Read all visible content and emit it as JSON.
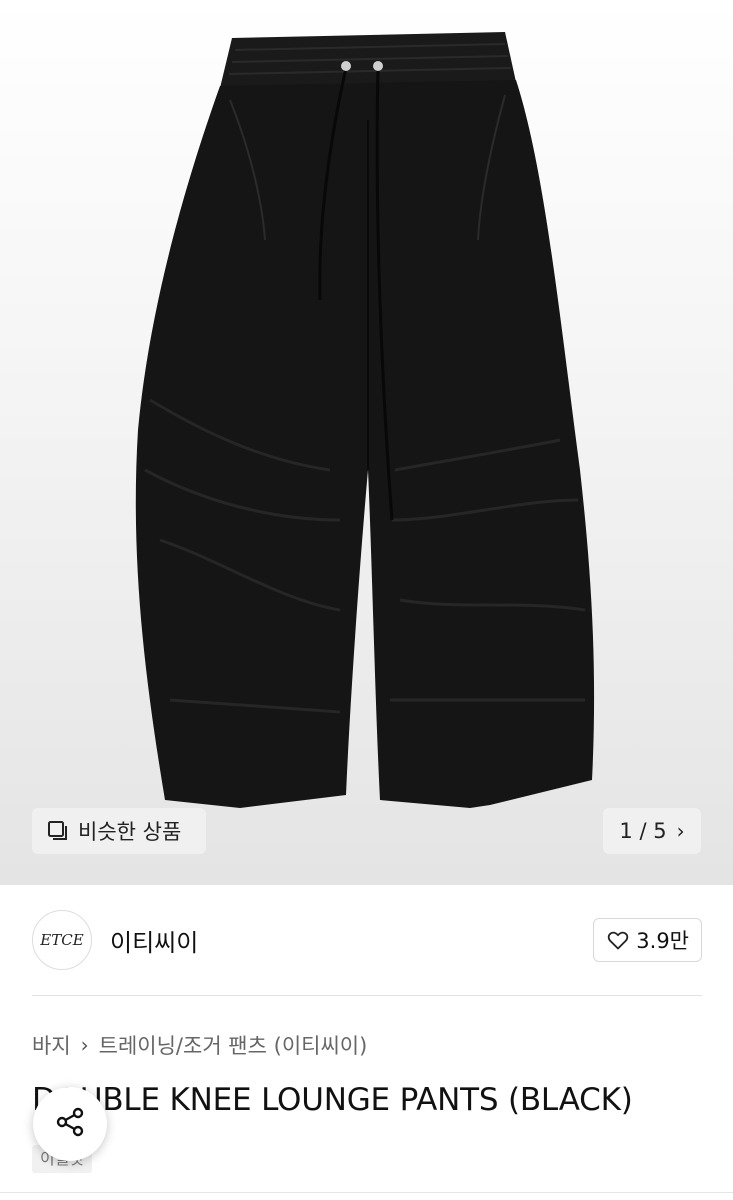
{
  "gallery": {
    "image_alt": "DOUBLE KNEE LOUNGE PANTS (BLACK)",
    "similar_label": "비슷한 상품",
    "pager_label": "1 / 5"
  },
  "brand": {
    "logo_text": "ETCE",
    "name": "이티씨이",
    "likes": "3.9만"
  },
  "breadcrumb": {
    "level1": "바지",
    "level2": "트레이닝/조거 팬츠 (이티씨이)"
  },
  "product": {
    "title": "DOUBLE KNEE LOUNGE PANTS (BLACK)",
    "badge": "이월샷"
  },
  "colors": {
    "pants": "#151515",
    "background": "#ffffff"
  }
}
